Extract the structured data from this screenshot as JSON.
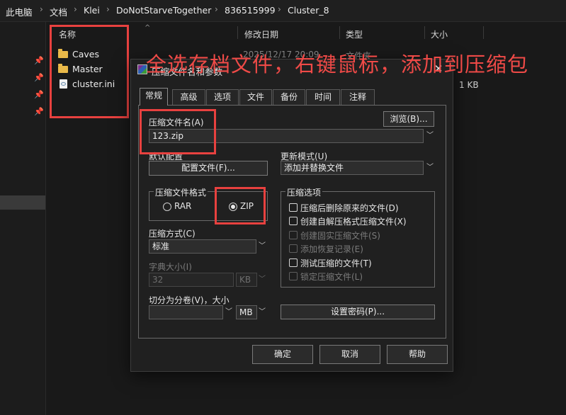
{
  "breadcrumb": [
    "此电脑",
    "文档",
    "Klei",
    "DoNotStarveTogether",
    "836515999",
    "Cluster_8"
  ],
  "columns": {
    "name": "名称",
    "date": "修改日期",
    "type": "类型",
    "size": "大小"
  },
  "files": [
    {
      "name": "Caves",
      "icon": "folder-icon"
    },
    {
      "name": "Master",
      "icon": "folder-icon"
    },
    {
      "name": "cluster.ini",
      "icon": "ini-file-icon"
    }
  ],
  "file_meta": {
    "date_fragment": "2025/12/17 20:09",
    "type_fragment": "文件夹",
    "size": "1 KB"
  },
  "annotation": "全选存档文件，右键鼠标，添加到压缩包",
  "dialog": {
    "title": "压缩文件名和参数",
    "tabs": [
      "常规",
      "高级",
      "选项",
      "文件",
      "备份",
      "时间",
      "注释"
    ],
    "archive_name_label": "压缩文件名(A)",
    "archive_name_value": "123.zip",
    "browse_button": "浏览(B)...",
    "default_config_label": "默认配置",
    "config_button": "配置文件(F)...",
    "update_mode_label": "更新模式(U)",
    "update_mode_value": "添加并替换文件",
    "format_group": "压缩文件格式",
    "format_rar": "RAR",
    "format_zip": "ZIP",
    "format_selected": "ZIP",
    "method_label": "压缩方式(C)",
    "method_value": "标准",
    "dict_label": "字典大小(I)",
    "dict_value": "32",
    "dict_unit": "KB",
    "split_label": "切分为分卷(V)，大小",
    "split_value": "",
    "split_unit": "MB",
    "options_group": "压缩选项",
    "options": [
      {
        "label": "压缩后删除原来的文件(D)",
        "enabled": true,
        "checked": false
      },
      {
        "label": "创建自解压格式压缩文件(X)",
        "enabled": true,
        "checked": false
      },
      {
        "label": "创建固实压缩文件(S)",
        "enabled": false,
        "checked": false
      },
      {
        "label": "添加恢复记录(E)",
        "enabled": false,
        "checked": false
      },
      {
        "label": "测试压缩的文件(T)",
        "enabled": true,
        "checked": false
      },
      {
        "label": "锁定压缩文件(L)",
        "enabled": false,
        "checked": false
      }
    ],
    "password_button": "设置密码(P)...",
    "ok_button": "确定",
    "cancel_button": "取消",
    "help_button": "帮助"
  },
  "colors": {
    "annotation_red": "#e8413f",
    "folder_yellow": "#e9b949",
    "background": "#191919"
  }
}
